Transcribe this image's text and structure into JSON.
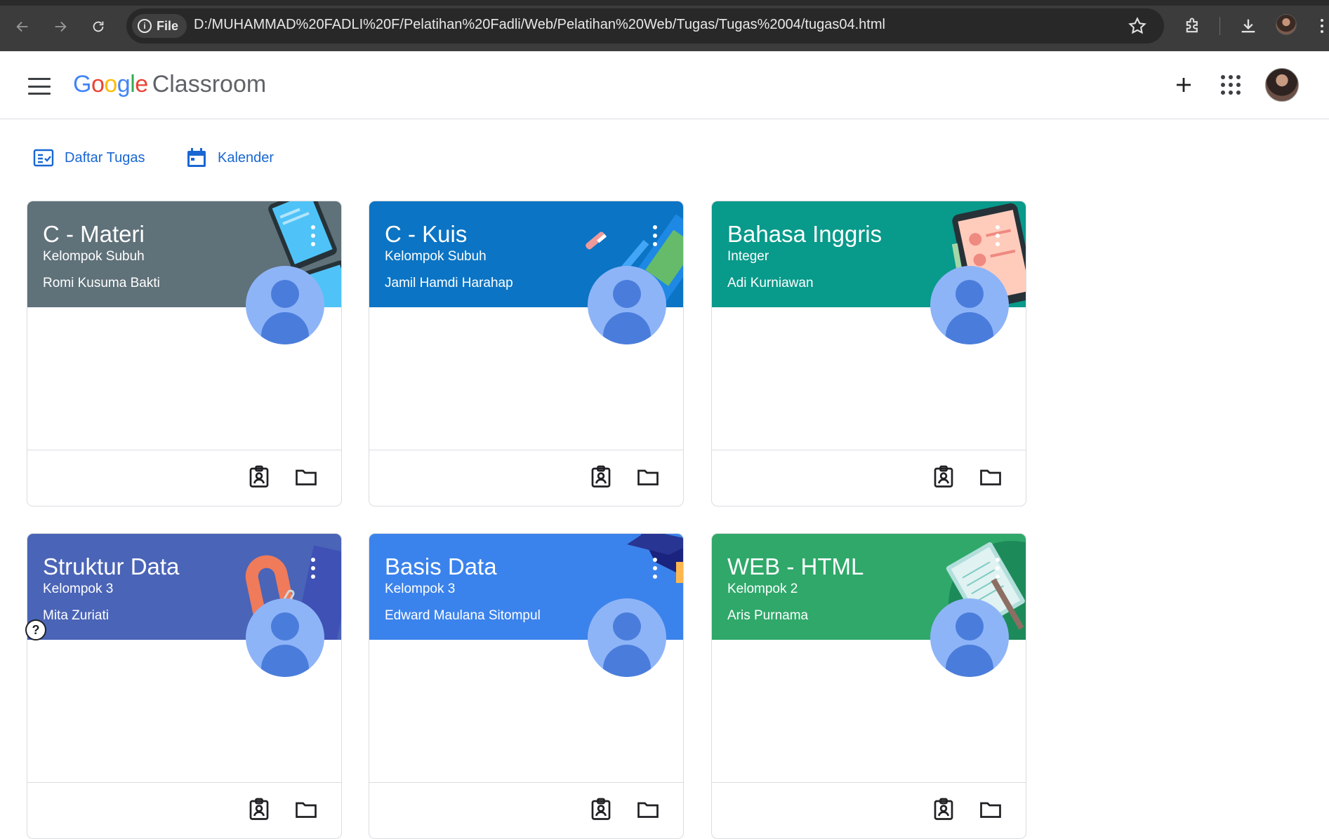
{
  "browser": {
    "site_chip_label": "File",
    "url": "D:/MUHAMMAD%20FADLI%20F/Pelatihan%20Fadli/Web/Pelatihan%20Web/Tugas/Tugas%2004/tugas04.html"
  },
  "header": {
    "logo_google": [
      "G",
      "o",
      "o",
      "g",
      "l",
      "e"
    ],
    "logo_colors": [
      "#4285f4",
      "#ea4335",
      "#fbbc04",
      "#4285f4",
      "#34a853",
      "#ea4335"
    ],
    "logo_product": "Classroom"
  },
  "subnav": {
    "todo_label": "Daftar Tugas",
    "calendar_label": "Kalender"
  },
  "accent_color": "#1967d2",
  "classes": [
    {
      "title": "C - Materi",
      "section": "Kelompok Subuh",
      "teacher": "Romi Kusuma Bakti",
      "color": "#5f7179",
      "theme": "phone-devices"
    },
    {
      "title": "C - Kuis",
      "section": "Kelompok Subuh",
      "teacher": "Jamil Hamdi Harahap",
      "color": "#0b74c4",
      "theme": "pens-books"
    },
    {
      "title": "Bahasa Inggris",
      "section": "Integer",
      "teacher": "Adi Kurniawan",
      "color": "#089a8a",
      "theme": "tablet"
    },
    {
      "title": "Struktur Data",
      "section": "Kelompok 3",
      "teacher": "Mita Zuriati",
      "color": "#4a64b7",
      "theme": "magnet"
    },
    {
      "title": "Basis Data",
      "section": "Kelompok 3",
      "teacher": "Edward Maulana Sitompul",
      "color": "#3b83ec",
      "theme": "graduation-cap"
    },
    {
      "title": "WEB - HTML",
      "section": "Kelompok 2",
      "teacher": "Aris Purnama",
      "color": "#2fa86a",
      "theme": "notebook"
    }
  ]
}
